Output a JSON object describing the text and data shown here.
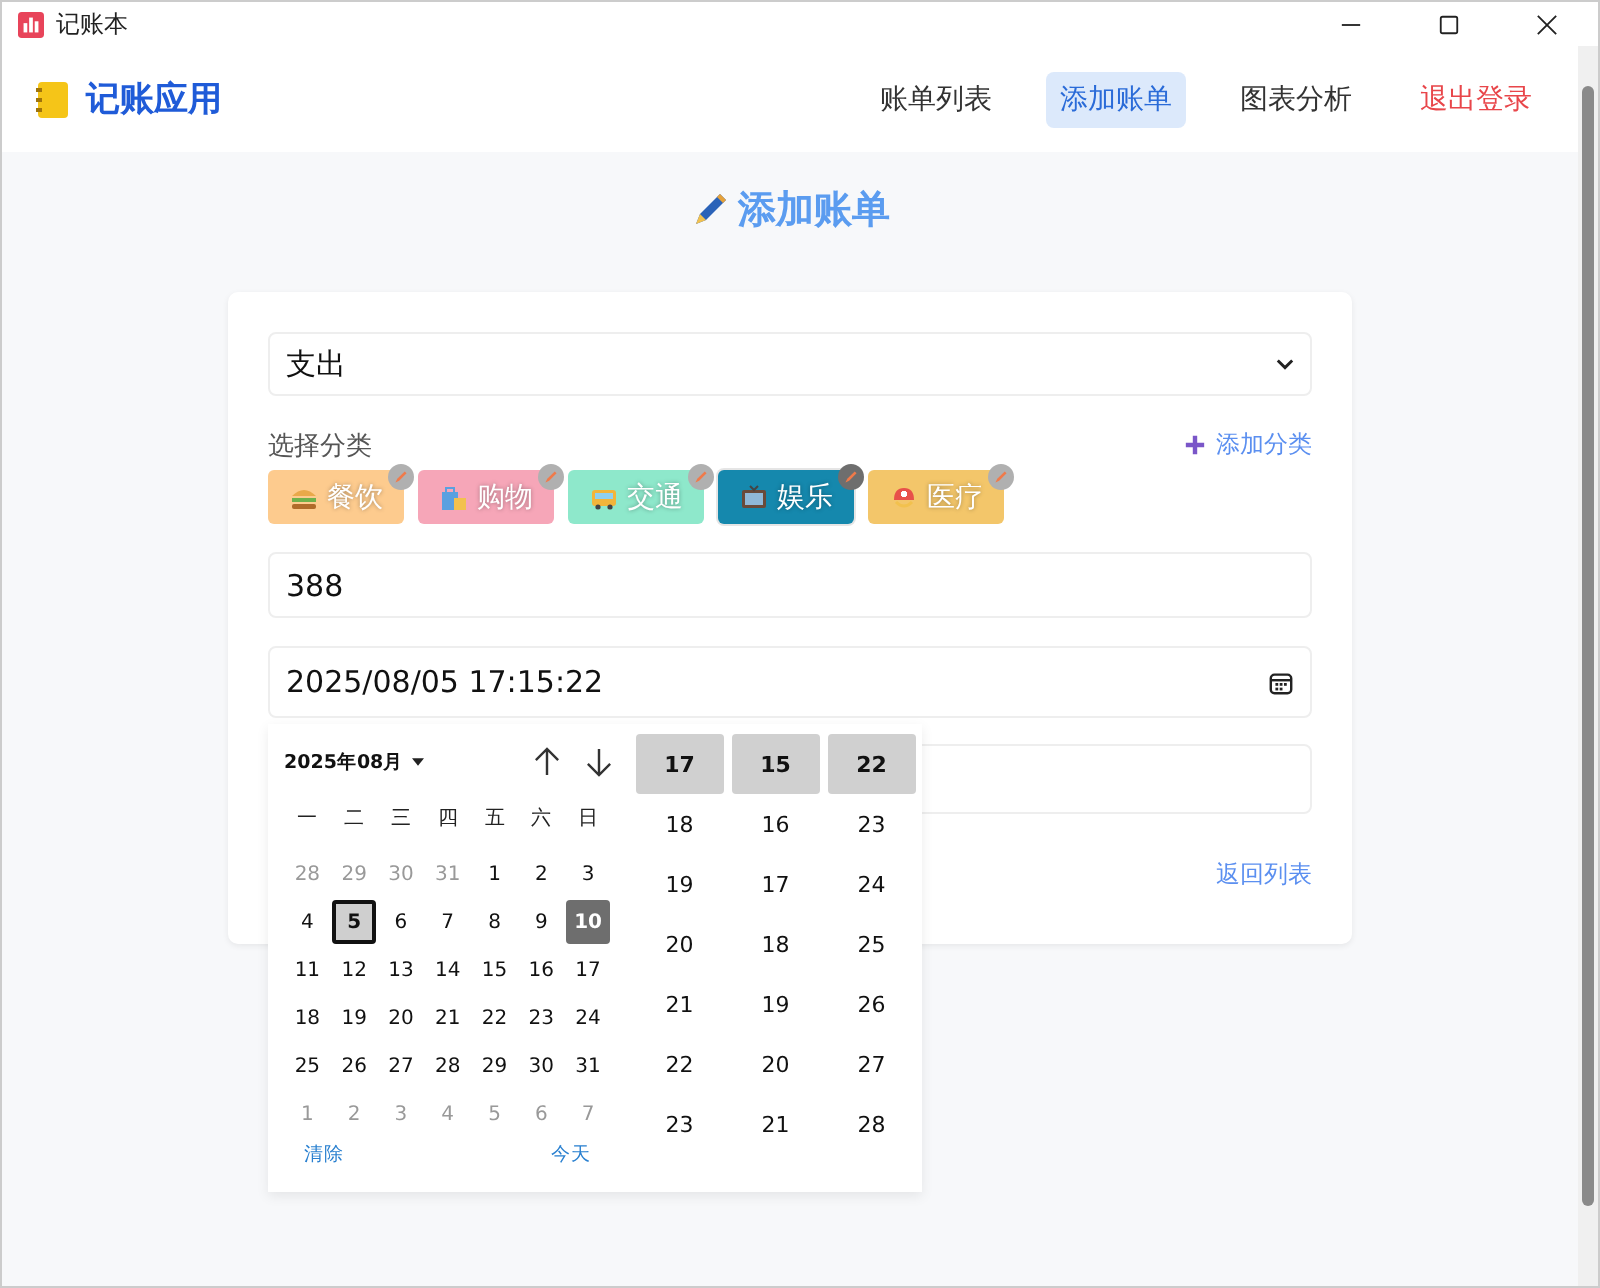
{
  "window": {
    "title": "记账本"
  },
  "header": {
    "brand": "记账应用",
    "nav": [
      {
        "label": "账单列表",
        "selected": false,
        "kind": "link"
      },
      {
        "label": "添加账单",
        "selected": true,
        "kind": "link"
      },
      {
        "label": "图表分析",
        "selected": false,
        "kind": "link"
      },
      {
        "label": "退出登录",
        "selected": false,
        "kind": "logout"
      }
    ]
  },
  "page_title": "添加账单",
  "form": {
    "type_select": "支出",
    "category_label": "选择分类",
    "add_category": "添加分类",
    "categories": [
      {
        "label": "餐饮",
        "kind": "food",
        "color": "#fdcb8e",
        "selected": false
      },
      {
        "label": "购物",
        "kind": "shopping",
        "color": "#f6a6b8",
        "selected": false
      },
      {
        "label": "交通",
        "kind": "transport",
        "color": "#8ee8cb",
        "selected": false
      },
      {
        "label": "娱乐",
        "kind": "entertainment",
        "color": "#1588ad",
        "selected": true
      },
      {
        "label": "医疗",
        "kind": "medical",
        "color": "#f3c66a",
        "selected": false
      }
    ],
    "amount": "388",
    "datetime": "2025/08/05  17:15:22",
    "back_link": "返回列表"
  },
  "picker": {
    "month": "2025年08月",
    "weekdays": [
      "一",
      "二",
      "三",
      "四",
      "五",
      "六",
      "日"
    ],
    "weeks": [
      [
        {
          "d": "28",
          "muted": true,
          "selected": false,
          "today": false
        },
        {
          "d": "29",
          "muted": true,
          "selected": false,
          "today": false
        },
        {
          "d": "30",
          "muted": true,
          "selected": false,
          "today": false
        },
        {
          "d": "31",
          "muted": true,
          "selected": false,
          "today": false
        },
        {
          "d": "1",
          "muted": false,
          "selected": false,
          "today": false
        },
        {
          "d": "2",
          "muted": false,
          "selected": false,
          "today": false
        },
        {
          "d": "3",
          "muted": false,
          "selected": false,
          "today": false
        }
      ],
      [
        {
          "d": "4",
          "muted": false,
          "selected": false,
          "today": false
        },
        {
          "d": "5",
          "muted": false,
          "selected": true,
          "today": false
        },
        {
          "d": "6",
          "muted": false,
          "selected": false,
          "today": false
        },
        {
          "d": "7",
          "muted": false,
          "selected": false,
          "today": false
        },
        {
          "d": "8",
          "muted": false,
          "selected": false,
          "today": false
        },
        {
          "d": "9",
          "muted": false,
          "selected": false,
          "today": false
        },
        {
          "d": "10",
          "muted": false,
          "selected": false,
          "today": true
        }
      ],
      [
        {
          "d": "11",
          "muted": false,
          "selected": false,
          "today": false
        },
        {
          "d": "12",
          "muted": false,
          "selected": false,
          "today": false
        },
        {
          "d": "13",
          "muted": false,
          "selected": false,
          "today": false
        },
        {
          "d": "14",
          "muted": false,
          "selected": false,
          "today": false
        },
        {
          "d": "15",
          "muted": false,
          "selected": false,
          "today": false
        },
        {
          "d": "16",
          "muted": false,
          "selected": false,
          "today": false
        },
        {
          "d": "17",
          "muted": false,
          "selected": false,
          "today": false
        }
      ],
      [
        {
          "d": "18",
          "muted": false,
          "selected": false,
          "today": false
        },
        {
          "d": "19",
          "muted": false,
          "selected": false,
          "today": false
        },
        {
          "d": "20",
          "muted": false,
          "selected": false,
          "today": false
        },
        {
          "d": "21",
          "muted": false,
          "selected": false,
          "today": false
        },
        {
          "d": "22",
          "muted": false,
          "selected": false,
          "today": false
        },
        {
          "d": "23",
          "muted": false,
          "selected": false,
          "today": false
        },
        {
          "d": "24",
          "muted": false,
          "selected": false,
          "today": false
        }
      ],
      [
        {
          "d": "25",
          "muted": false,
          "selected": false,
          "today": false
        },
        {
          "d": "26",
          "muted": false,
          "selected": false,
          "today": false
        },
        {
          "d": "27",
          "muted": false,
          "selected": false,
          "today": false
        },
        {
          "d": "28",
          "muted": false,
          "selected": false,
          "today": false
        },
        {
          "d": "29",
          "muted": false,
          "selected": false,
          "today": false
        },
        {
          "d": "30",
          "muted": false,
          "selected": false,
          "today": false
        },
        {
          "d": "31",
          "muted": false,
          "selected": false,
          "today": false
        }
      ],
      [
        {
          "d": "1",
          "muted": true,
          "selected": false,
          "today": false
        },
        {
          "d": "2",
          "muted": true,
          "selected": false,
          "today": false
        },
        {
          "d": "3",
          "muted": true,
          "selected": false,
          "today": false
        },
        {
          "d": "4",
          "muted": true,
          "selected": false,
          "today": false
        },
        {
          "d": "5",
          "muted": true,
          "selected": false,
          "today": false
        },
        {
          "d": "6",
          "muted": true,
          "selected": false,
          "today": false
        },
        {
          "d": "7",
          "muted": true,
          "selected": false,
          "today": false
        }
      ]
    ],
    "clear": "清除",
    "today": "今天",
    "time_columns": [
      [
        {
          "v": "17",
          "selected": true
        },
        {
          "v": "18",
          "selected": false
        },
        {
          "v": "19",
          "selected": false
        },
        {
          "v": "20",
          "selected": false
        },
        {
          "v": "21",
          "selected": false
        },
        {
          "v": "22",
          "selected": false
        },
        {
          "v": "23",
          "selected": false
        }
      ],
      [
        {
          "v": "15",
          "selected": true
        },
        {
          "v": "16",
          "selected": false
        },
        {
          "v": "17",
          "selected": false
        },
        {
          "v": "18",
          "selected": false
        },
        {
          "v": "19",
          "selected": false
        },
        {
          "v": "20",
          "selected": false
        },
        {
          "v": "21",
          "selected": false
        }
      ],
      [
        {
          "v": "22",
          "selected": true
        },
        {
          "v": "23",
          "selected": false
        },
        {
          "v": "24",
          "selected": false
        },
        {
          "v": "25",
          "selected": false
        },
        {
          "v": "26",
          "selected": false
        },
        {
          "v": "27",
          "selected": false
        },
        {
          "v": "28",
          "selected": false
        }
      ]
    ]
  }
}
